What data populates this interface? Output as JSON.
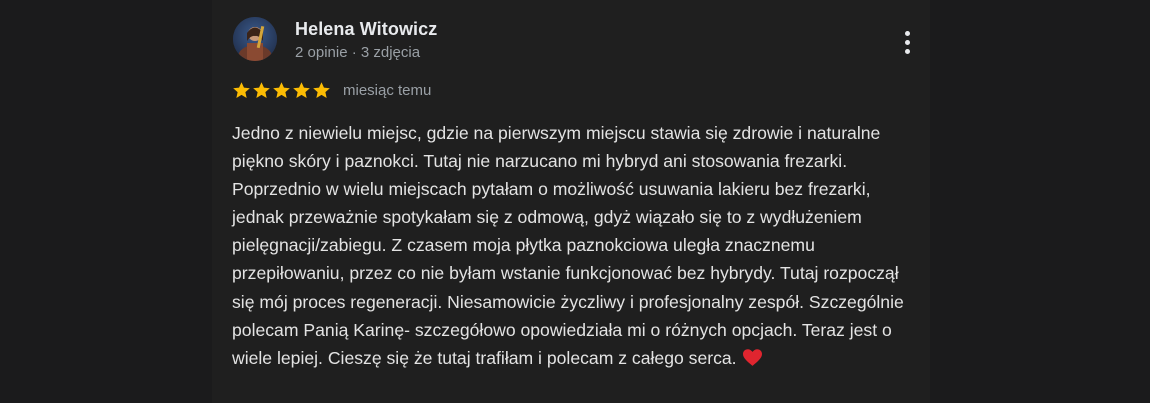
{
  "review": {
    "reviewer_name": "Helena Witowicz",
    "reviewer_meta": "2 opinie · 3 zdjęcia",
    "rating": 5,
    "rating_max": 5,
    "date": "miesiąc temu",
    "text": "Jedno z niewielu miejsc, gdzie na pierwszym miejscu stawia się zdrowie i naturalne piękno skóry i paznokci. Tutaj nie narzucano mi hybryd ani stosowania frezarki. Poprzednio w wielu miejscach pytałam o możliwość usuwania lakieru bez frezarki, jednak przeważnie spotykałam się z odmową, gdyż wiązało się to z wydłużeniem pielęgnacji/zabiegu. Z czasem moja płytka paznokciowa uległa znacznemu przepiłowaniu, przez co nie byłam wstanie funkcjonować bez hybrydy. Tutaj rozpoczął się mój proces regeneracji. Niesamowicie życzliwy i profesjonalny zespół. Szczególnie polecam Panią Karinę- szczegółowo opowiedziała mi o różnych opcjach. Teraz jest o wiele lepiej. Cieszę się że tutaj trafiłam i polecam z całego serca.",
    "emoji_icon": "red-heart-icon"
  },
  "colors": {
    "background": "#1f1f1f",
    "star": "#fbbc04",
    "name": "#e8eaed",
    "secondary_text": "#9aa0a6",
    "body_text": "#e3e3e3",
    "heart": "#e0252f"
  },
  "icons": {
    "menu": "more-vert-icon",
    "star": "star-icon"
  }
}
